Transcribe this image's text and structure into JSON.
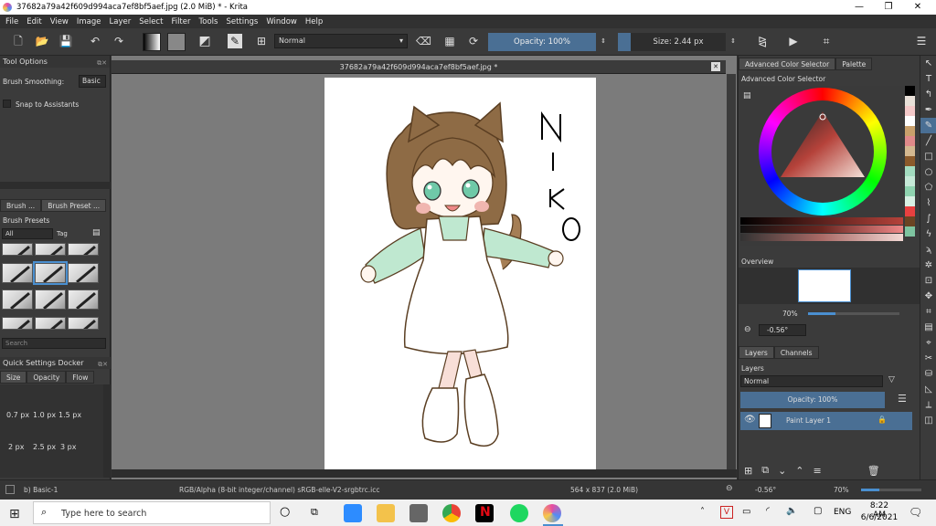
{
  "window": {
    "title": "37682a79a42f609d994aca7ef8bf5aef.jpg (2.0 MiB)  * - Krita",
    "minimize": "—",
    "maximize": "❐",
    "close": "✕"
  },
  "menu": [
    "File",
    "Edit",
    "View",
    "Image",
    "Layer",
    "Select",
    "Filter",
    "Tools",
    "Settings",
    "Window",
    "Help"
  ],
  "toolbar": {
    "blend_mode": "Normal",
    "opacity": "Opacity: 100%",
    "size": "Size: 2.44 px"
  },
  "left_dock": {
    "tool_options_title": "Tool Options",
    "brush_smoothing_label": "Brush Smoothing:",
    "brush_smoothing_value": "Basic",
    "snap_label": "Snap to Assistants",
    "tabs": [
      "Brush ...",
      "Brush Preset ..."
    ],
    "brush_presets_title": "Brush Presets",
    "filter_all": "All",
    "tag_label": "Tag",
    "search_placeholder": "Search",
    "quick_settings_title": "Quick Settings Docker",
    "quick_tabs": [
      "Size",
      "Opacity",
      "Flow"
    ],
    "sizes_row1": [
      "0.7 px",
      "1.0 px",
      "1.5 px"
    ],
    "sizes_row2": [
      "2 px",
      "2.5 px",
      "3 px"
    ]
  },
  "document": {
    "tab_title": "37682a79a42f609d994aca7ef8bf5aef.jpg *",
    "drawing_text": "NIKO"
  },
  "right_dock": {
    "tabs": [
      "Advanced Color Selector",
      "Palette"
    ],
    "color_selector_title": "Advanced Color Selector",
    "overview_title": "Overview",
    "zoom_value": "70%",
    "rotation_value": "-0.56°",
    "layer_tabs": [
      "Layers",
      "Channels"
    ],
    "layers_title": "Layers",
    "layer_blend": "Normal",
    "layer_opacity": "Opacity:  100%",
    "layer_name": "Paint Layer 1",
    "palette_colors": [
      "#000000",
      "#e8e0d8",
      "#f4c9c9",
      "#ffffff",
      "#c9a06b",
      "#e08a8a",
      "#d4b890",
      "#8b5a2b",
      "#a3dcc0",
      "#c6ead8",
      "#8fd4b0",
      "#d8f1e4",
      "#e84040",
      "#6b4423",
      "#7ec4a0",
      "#ffffff"
    ]
  },
  "status": {
    "brush": "b) Basic-1",
    "color_model": "RGB/Alpha (8-bit integer/channel)  sRGB-elle-V2-srgbtrc.icc",
    "dimensions": "564 x 837 (2.0 MiB)",
    "rotation": "-0.56°",
    "zoom": "70%"
  },
  "taskbar": {
    "search_placeholder": "Type here to search",
    "language": "ENG",
    "time": "8:22 AM",
    "date": "6/6/2021"
  }
}
